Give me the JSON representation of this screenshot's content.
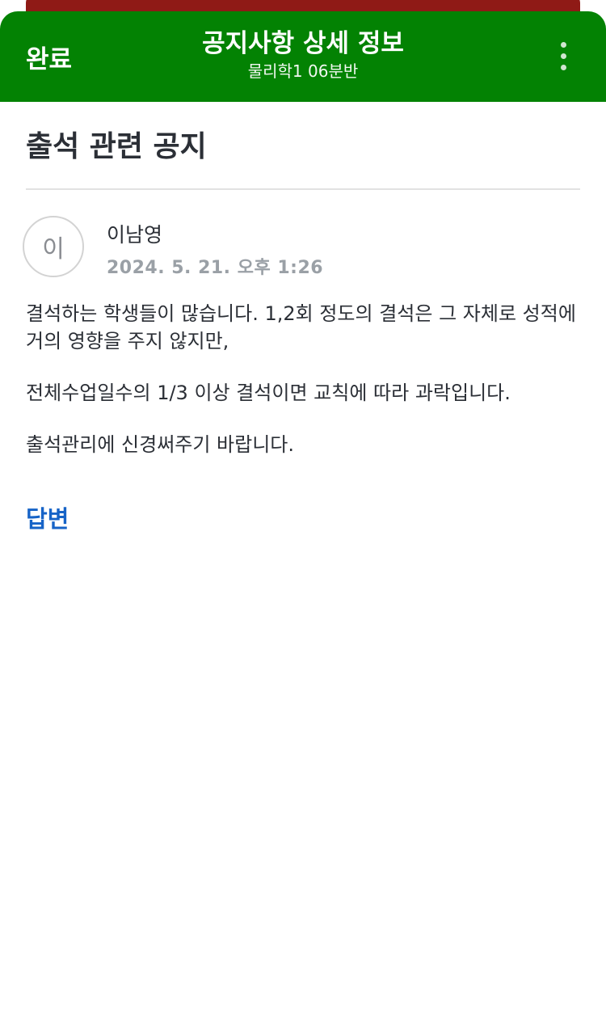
{
  "header": {
    "done_label": "완료",
    "title": "공지사항 상세 정보",
    "subtitle": "물리학1 06분반",
    "more_icon": "more-vertical-icon"
  },
  "notice": {
    "title": "출석 관련 공지",
    "author": {
      "avatar_initial": "이",
      "name": "이남영"
    },
    "date": "2024. 5. 21. 오후 1:26",
    "paragraphs": [
      "결석하는 학생들이 많습니다. 1,2회 정도의 결석은 그 자체로 성적에 거의 영향을 주지 않지만,",
      "전체수업일수의 1/3 이상 결석이면 교칙에 따라 과락입니다.",
      "출석관리에 신경써주기 바랍니다."
    ],
    "reply_label": "답변"
  },
  "colors": {
    "header_bg": "#038203",
    "behind_card": "#8f1a16",
    "link": "#1663c7"
  }
}
